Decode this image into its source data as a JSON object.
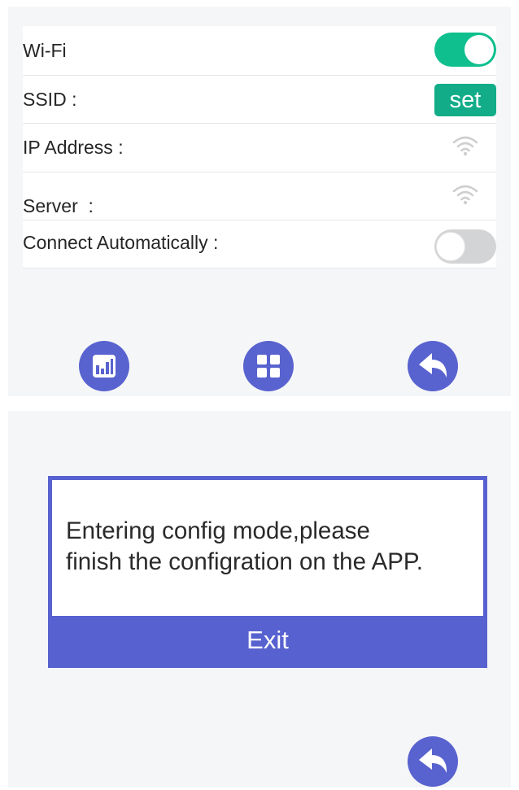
{
  "wifi_settings": {
    "wifi_label": "Wi-Fi",
    "wifi_enabled": true,
    "ssid_label": "SSID :",
    "ssid_set_label": "set",
    "ip_label": "IP Address :",
    "server_label": "Server  :",
    "auto_connect_label": "Connect Automatically :",
    "auto_connect_enabled": false
  },
  "nav": {
    "icons": [
      "chart-icon",
      "grid-icon",
      "back-arrow-icon"
    ]
  },
  "config_dialog": {
    "message_line1": "Entering config mode,please",
    "message_line2": "finish the configration on the APP.",
    "exit_label": "Exit"
  },
  "colors": {
    "accent_green": "#0fbf8e",
    "accent_blue": "#5761cf",
    "toggle_off": "#d3d4d6"
  }
}
